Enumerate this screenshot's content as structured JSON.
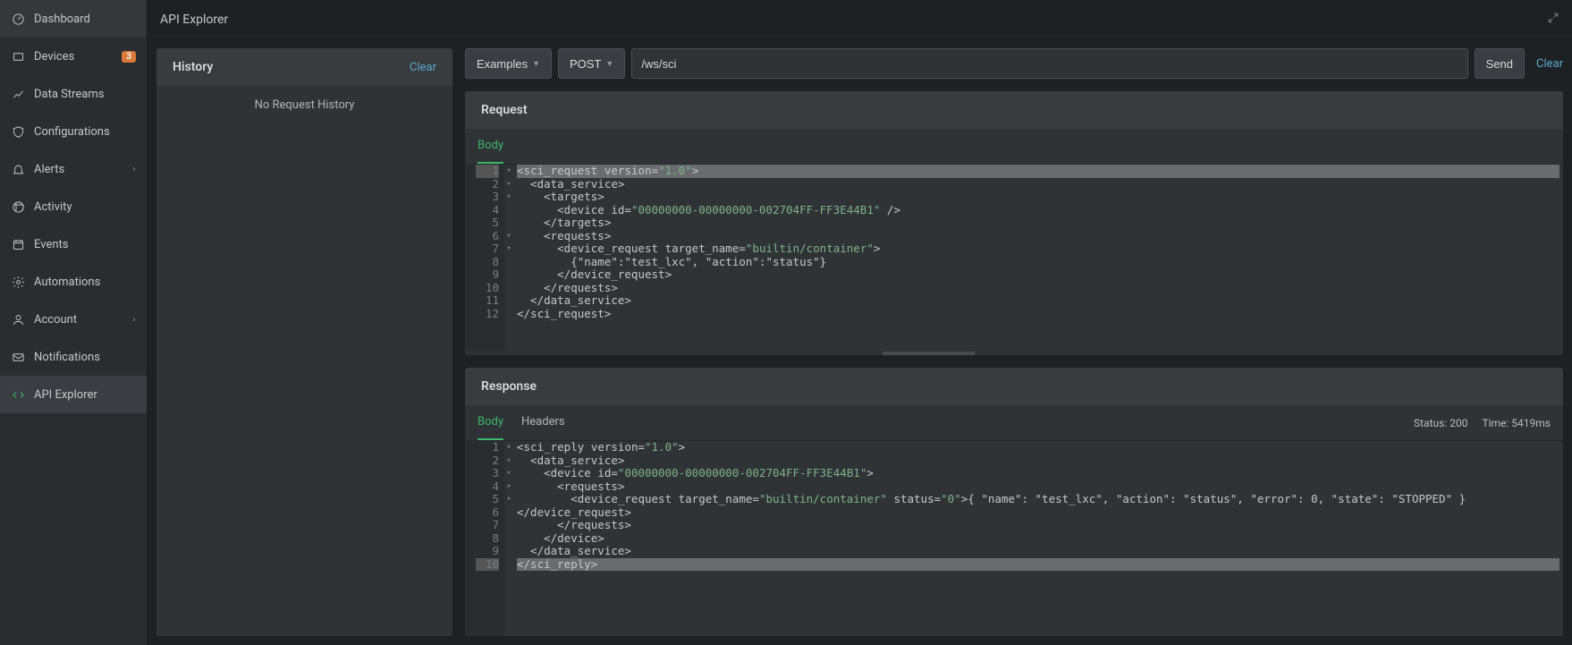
{
  "page_title": "API Explorer",
  "sidebar": {
    "items": [
      {
        "id": "dashboard",
        "label": "Dashboard",
        "icon": "gauge",
        "badge": null,
        "expandable": false
      },
      {
        "id": "devices",
        "label": "Devices",
        "icon": "device",
        "badge": "3",
        "expandable": false
      },
      {
        "id": "data-streams",
        "label": "Data Streams",
        "icon": "chart",
        "badge": null,
        "expandable": false
      },
      {
        "id": "configurations",
        "label": "Configurations",
        "icon": "shield",
        "badge": null,
        "expandable": false
      },
      {
        "id": "alerts",
        "label": "Alerts",
        "icon": "bell",
        "badge": null,
        "expandable": true
      },
      {
        "id": "activity",
        "label": "Activity",
        "icon": "activity",
        "badge": null,
        "expandable": false
      },
      {
        "id": "events",
        "label": "Events",
        "icon": "calendar",
        "badge": null,
        "expandable": false
      },
      {
        "id": "automations",
        "label": "Automations",
        "icon": "gear",
        "badge": null,
        "expandable": false
      },
      {
        "id": "account",
        "label": "Account",
        "icon": "user",
        "badge": null,
        "expandable": true
      },
      {
        "id": "notifications",
        "label": "Notifications",
        "icon": "mail",
        "badge": null,
        "expandable": false
      },
      {
        "id": "api-explorer",
        "label": "API Explorer",
        "icon": "code",
        "badge": null,
        "expandable": false,
        "active": true
      }
    ]
  },
  "history": {
    "title": "History",
    "clear_label": "Clear",
    "empty_text": "No Request History"
  },
  "toolbar": {
    "examples_label": "Examples",
    "method": "POST",
    "path": "/ws/sci",
    "send_label": "Send",
    "clear_label": "Clear"
  },
  "request_panel": {
    "title": "Request",
    "tabs": [
      "Body"
    ],
    "active_tab": "Body",
    "code": [
      {
        "n": 1,
        "fold": true,
        "hl": true,
        "tokens": [
          [
            "tag",
            "<sci_request "
          ],
          [
            "attr",
            "version="
          ],
          [
            "str",
            "\"1.0\""
          ],
          [
            "tag",
            ">"
          ]
        ]
      },
      {
        "n": 2,
        "fold": true,
        "tokens": [
          [
            "tag",
            "  <data_service>"
          ]
        ]
      },
      {
        "n": 3,
        "fold": true,
        "tokens": [
          [
            "tag",
            "    <targets>"
          ]
        ]
      },
      {
        "n": 4,
        "fold": false,
        "tokens": [
          [
            "tag",
            "      <device "
          ],
          [
            "attr",
            "id="
          ],
          [
            "str",
            "\"00000000-00000000-002704FF-FF3E44B1\""
          ],
          [
            "tag",
            " />"
          ]
        ]
      },
      {
        "n": 5,
        "fold": false,
        "tokens": [
          [
            "tag",
            "    </targets>"
          ]
        ]
      },
      {
        "n": 6,
        "fold": true,
        "tokens": [
          [
            "tag",
            "    <requests>"
          ]
        ]
      },
      {
        "n": 7,
        "fold": true,
        "tokens": [
          [
            "tag",
            "      <device_request "
          ],
          [
            "attr",
            "target_name="
          ],
          [
            "str",
            "\"builtin/container\""
          ],
          [
            "tag",
            ">"
          ]
        ]
      },
      {
        "n": 8,
        "fold": false,
        "tokens": [
          [
            "txt",
            "        {\"name\":\"test_lxc\", \"action\":\"status\"}"
          ]
        ]
      },
      {
        "n": 9,
        "fold": false,
        "tokens": [
          [
            "tag",
            "      </device_request>"
          ]
        ]
      },
      {
        "n": 10,
        "fold": false,
        "tokens": [
          [
            "tag",
            "    </requests>"
          ]
        ]
      },
      {
        "n": 11,
        "fold": false,
        "tokens": [
          [
            "tag",
            "  </data_service>"
          ]
        ]
      },
      {
        "n": 12,
        "fold": false,
        "tokens": [
          [
            "tag",
            "</sci_request>"
          ]
        ]
      }
    ]
  },
  "response_panel": {
    "title": "Response",
    "tabs": [
      "Body",
      "Headers"
    ],
    "active_tab": "Body",
    "status_label": "Status: 200",
    "time_label": "Time: 5419ms",
    "code": [
      {
        "n": 1,
        "fold": true,
        "tokens": [
          [
            "tag",
            "<sci_reply "
          ],
          [
            "attr",
            "version="
          ],
          [
            "str",
            "\"1.0\""
          ],
          [
            "tag",
            ">"
          ]
        ]
      },
      {
        "n": 2,
        "fold": true,
        "tokens": [
          [
            "tag",
            "  <data_service>"
          ]
        ]
      },
      {
        "n": 3,
        "fold": true,
        "tokens": [
          [
            "tag",
            "    <device "
          ],
          [
            "attr",
            "id="
          ],
          [
            "str",
            "\"00000000-00000000-002704FF-FF3E44B1\""
          ],
          [
            "tag",
            ">"
          ]
        ]
      },
      {
        "n": 4,
        "fold": true,
        "tokens": [
          [
            "tag",
            "      <requests>"
          ]
        ]
      },
      {
        "n": 5,
        "fold": true,
        "tokens": [
          [
            "tag",
            "        <device_request "
          ],
          [
            "attr",
            "target_name="
          ],
          [
            "str",
            "\"builtin/container\""
          ],
          [
            "tag",
            " "
          ],
          [
            "attr",
            "status="
          ],
          [
            "str",
            "\"0\""
          ],
          [
            "tag",
            ">"
          ],
          [
            "txt",
            "{ \"name\": \"test_lxc\", \"action\": \"status\", \"error\": 0, \"state\": \"STOPPED\" }"
          ]
        ]
      },
      {
        "n": 6,
        "fold": false,
        "tokens": [
          [
            "tag",
            "</device_request>"
          ]
        ]
      },
      {
        "n": 7,
        "fold": false,
        "tokens": [
          [
            "tag",
            "      </requests>"
          ]
        ]
      },
      {
        "n": 8,
        "fold": false,
        "tokens": [
          [
            "tag",
            "    </device>"
          ]
        ]
      },
      {
        "n": 9,
        "fold": false,
        "tokens": [
          [
            "tag",
            "  </data_service>"
          ]
        ]
      },
      {
        "n": 10,
        "fold": false,
        "hl": true,
        "tokens": [
          [
            "tag",
            "</sci_reply>"
          ]
        ]
      }
    ]
  }
}
